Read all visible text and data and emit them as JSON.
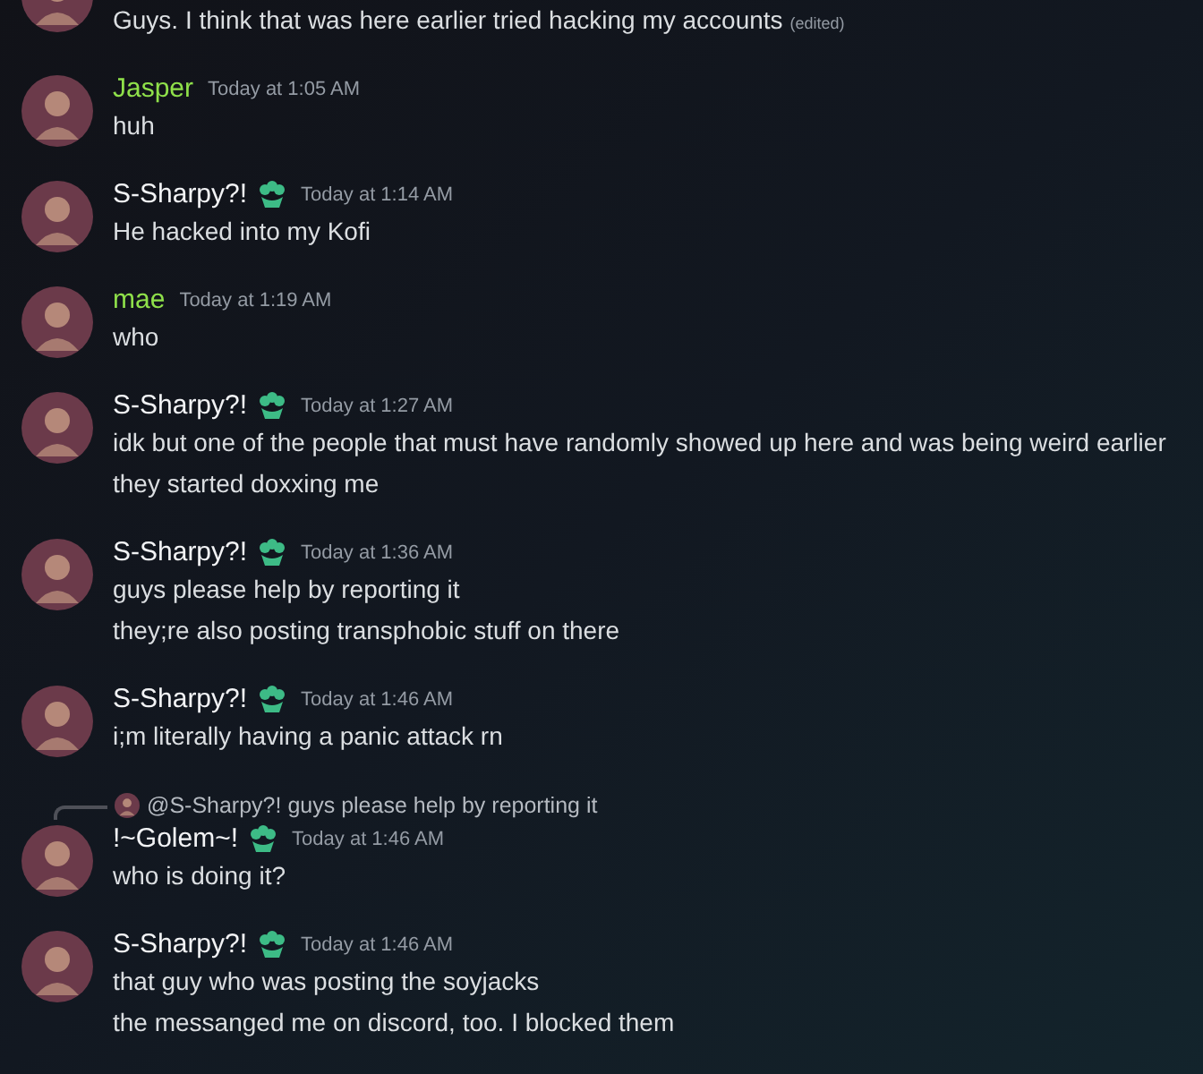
{
  "messages": [
    {
      "kind": "continuation",
      "lines": [
        "Guys. I think that was here earlier tried hacking my accounts"
      ],
      "edited": "(edited)"
    },
    {
      "kind": "message",
      "author": "Jasper",
      "color": "#8fe04a",
      "badge": false,
      "time": "Today at 1:05 AM",
      "lines": [
        "huh"
      ]
    },
    {
      "kind": "message",
      "author": "S-Sharpy?!",
      "color": "#f2f3f5",
      "badge": true,
      "time": "Today at 1:14 AM",
      "lines": [
        "He hacked into my Kofi"
      ]
    },
    {
      "kind": "message",
      "author": "mae",
      "color": "#8fe04a",
      "badge": false,
      "time": "Today at 1:19 AM",
      "lines": [
        "who"
      ]
    },
    {
      "kind": "message",
      "author": "S-Sharpy?!",
      "color": "#f2f3f5",
      "badge": true,
      "time": "Today at 1:27 AM",
      "lines": [
        "idk but one of the people that must have randomly showed up here and was being weird earlier",
        "they started doxxing me"
      ]
    },
    {
      "kind": "message",
      "author": "S-Sharpy?!",
      "color": "#f2f3f5",
      "badge": true,
      "time": "Today at 1:36 AM",
      "lines": [
        "guys please help by reporting it",
        "they;re also posting transphobic stuff on there"
      ]
    },
    {
      "kind": "message",
      "author": "S-Sharpy?!",
      "color": "#f2f3f5",
      "badge": true,
      "time": "Today at 1:46 AM",
      "lines": [
        "i;m literally having a panic attack rn"
      ]
    },
    {
      "kind": "message",
      "author": "!~Golem~!",
      "color": "#f2f3f5",
      "badge": true,
      "time": "Today at 1:46 AM",
      "reply": {
        "text": "@S-Sharpy?! guys please help by reporting it"
      },
      "lines": [
        "who is doing it?"
      ]
    },
    {
      "kind": "message",
      "author": "S-Sharpy?!",
      "color": "#f2f3f5",
      "badge": true,
      "time": "Today at 1:46 AM",
      "lines": [
        "that guy who was posting the soyjacks",
        "the messanged me on discord, too. I blocked them"
      ]
    }
  ]
}
